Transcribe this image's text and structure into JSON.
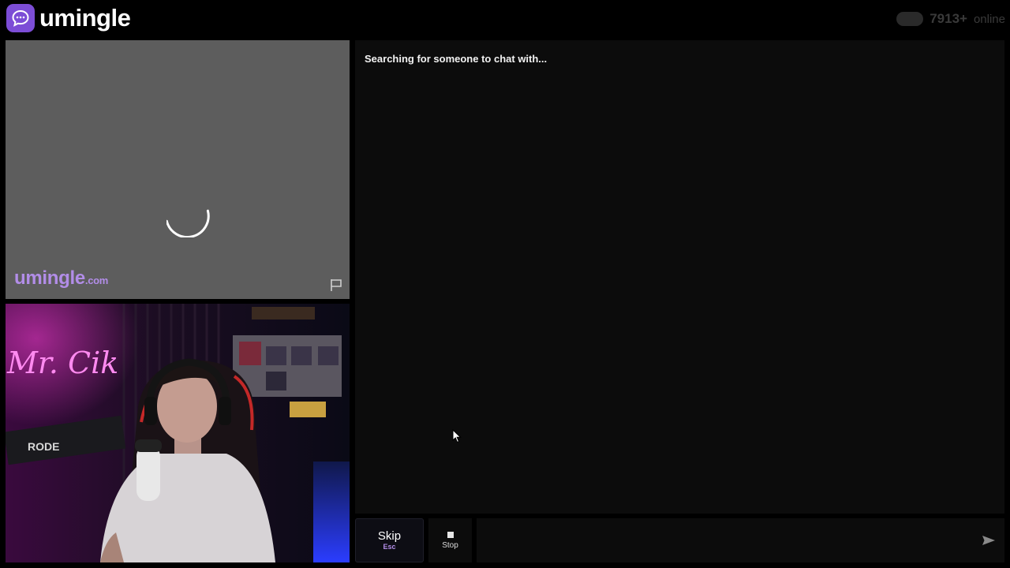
{
  "header": {
    "logo_text": "umingle",
    "online_count": "7913+",
    "online_label": "online"
  },
  "stranger_video": {
    "watermark_name": "umingle",
    "watermark_tld": ".com",
    "report_icon": "flag-icon"
  },
  "chat": {
    "status_text": "Searching for someone to chat with..."
  },
  "controls": {
    "skip_label": "Skip",
    "skip_shortcut": "Esc",
    "stop_label": "Stop",
    "message_placeholder": "",
    "send_icon": "send-icon"
  },
  "colors": {
    "brand": "#7c4dd6",
    "watermark": "#b28de8"
  }
}
